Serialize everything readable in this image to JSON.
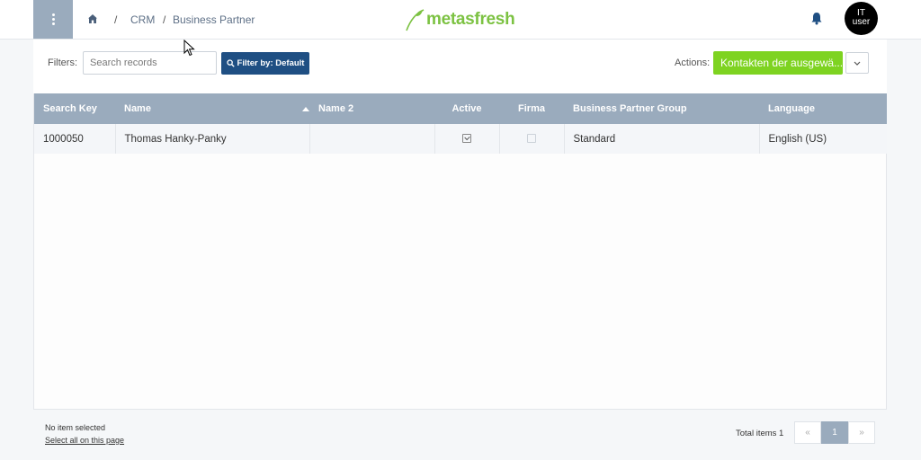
{
  "header": {
    "breadcrumb": [
      {
        "label": "CRM"
      },
      {
        "label": "Business Partner"
      }
    ],
    "logo_text": "metasfresh",
    "avatar_line1": "IT",
    "avatar_line2": "user"
  },
  "filters": {
    "label": "Filters:",
    "search_placeholder": "Search records",
    "search_value": "",
    "filter_button": "Filter by: Default"
  },
  "actions": {
    "label": "Actions:",
    "primary_button": "Kontakten der ausgewä..."
  },
  "table": {
    "columns": [
      "Search Key",
      "Name",
      "Name 2",
      "Active",
      "Firma",
      "Business Partner Group",
      "Language"
    ],
    "sorted_column": "Name",
    "rows": [
      {
        "search_key": "1000050",
        "name": "Thomas Hanky-Panky",
        "name2": "",
        "active": true,
        "firma": false,
        "group": "Standard",
        "language": "English (US)"
      }
    ]
  },
  "footer": {
    "selection_text": "No item selected",
    "select_all": "Select all on this page",
    "total_text": "Total items 1",
    "pager_prev": "«",
    "current_page": "1",
    "pager_next": "»"
  },
  "colors": {
    "header_row": "#9aabbd",
    "filter_button": "#1f4f83",
    "action_button": "#7ed321",
    "brand": "#7cc242"
  },
  "icons": [
    "menu-icon",
    "home-icon",
    "bell-icon",
    "search-icon",
    "chevron-down-icon",
    "sort-asc-icon",
    "mouse-cursor-icon"
  ]
}
